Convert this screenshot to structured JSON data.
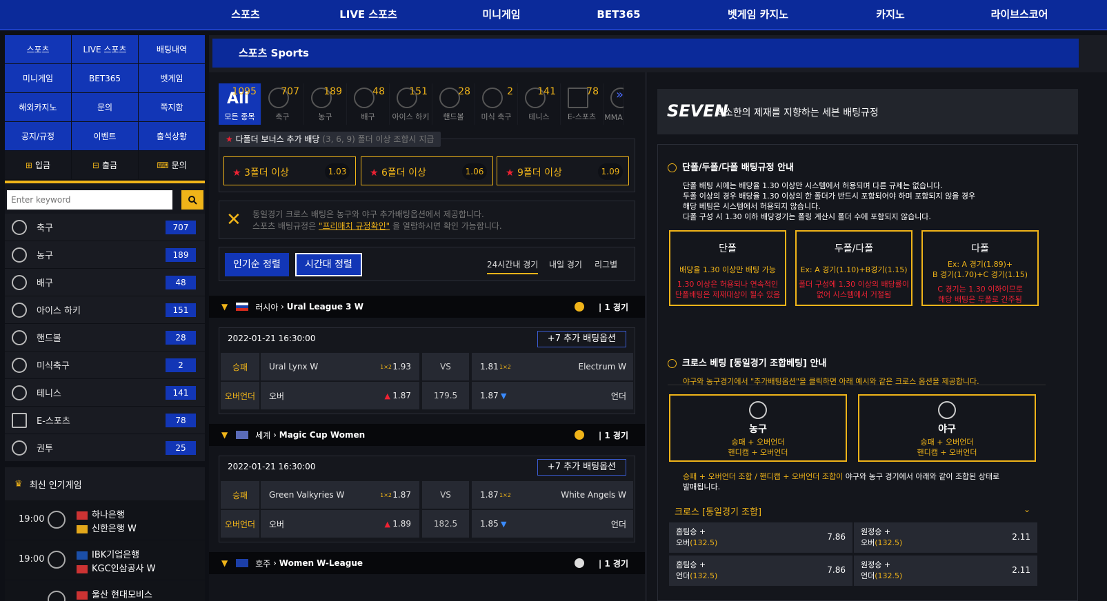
{
  "topnav": [
    "스포츠",
    "LIVE 스포츠",
    "미니게임",
    "BET365",
    "벳게임 카지노",
    "카지노",
    "라이브스코어"
  ],
  "sidenav": [
    "스포츠",
    "LIVE 스포츠",
    "배팅내역",
    "미니게임",
    "BET365",
    "벳게임",
    "해외카지노",
    "문의",
    "쪽지함",
    "공지/규정",
    "이벤트",
    "출석상황"
  ],
  "actions": [
    "입금",
    "출금",
    "문의"
  ],
  "search": {
    "placeholder": "Enter keyword"
  },
  "sports": [
    {
      "name": "축구",
      "count": "707"
    },
    {
      "name": "농구",
      "count": "189"
    },
    {
      "name": "배구",
      "count": "48"
    },
    {
      "name": "아이스 하키",
      "count": "151"
    },
    {
      "name": "핸드볼",
      "count": "28"
    },
    {
      "name": "미식축구",
      "count": "2"
    },
    {
      "name": "테니스",
      "count": "141"
    },
    {
      "name": "E-스포츠",
      "count": "78"
    },
    {
      "name": "권투",
      "count": "25"
    }
  ],
  "popular": {
    "title": "최신 인기게임",
    "games": [
      {
        "time": "19:00",
        "home": "하나은행",
        "away": "신한은행 W"
      },
      {
        "time": "19:00",
        "home": "IBK기업은행",
        "away": "KGC인삼공사 W"
      },
      {
        "time": "",
        "home": "울산 현대모비스",
        "away": ""
      }
    ]
  },
  "main_title": "스포츠 Sports",
  "sport_tabs": [
    {
      "label": "모든 종목",
      "count": "1095",
      "all": "All"
    },
    {
      "label": "축구",
      "count": "707"
    },
    {
      "label": "농구",
      "count": "189"
    },
    {
      "label": "배구",
      "count": "48"
    },
    {
      "label": "아이스 하키",
      "count": "151"
    },
    {
      "label": "핸드볼",
      "count": "28"
    },
    {
      "label": "미식 축구",
      "count": "2"
    },
    {
      "label": "테니스",
      "count": "141"
    },
    {
      "label": "E-스포츠",
      "count": "78"
    },
    {
      "label": "MMA",
      "count": ""
    }
  ],
  "bonus": {
    "tag": "다폴더 보너스 추가 배당",
    "tag_note": "(3, 6, 9) 폴더 이상 조합시 지급",
    "items": [
      {
        "label": "3폴더 이상",
        "odds": "1.03"
      },
      {
        "label": "6폴더 이상",
        "odds": "1.06"
      },
      {
        "label": "9폴더 이상",
        "odds": "1.09"
      }
    ]
  },
  "info": {
    "line1": "동일경기 크로스 배팅은 농구와 야구 추가배팅옵션에서 제공합니다.",
    "line2_pre": "스포츠 배팅규정은 ",
    "line2_link": "\"프리매치 규정확인\"",
    "line2_post": " 을 열람하시면 확인 가능합니다."
  },
  "sort": {
    "popular": "인기순 정렬",
    "time": "시간대 정렬",
    "tabs": [
      "24시간내 경기",
      "내일 경기",
      "리그별"
    ]
  },
  "leagues": [
    {
      "country": "러시아",
      "name": "Ural League 3 W",
      "count": "| 1 경기",
      "date": "2022-01-21 16:30:00",
      "more": "+7 추가 배팅옵션",
      "row1": {
        "type": "승패",
        "home": "Ural Lynx W",
        "home_odds": "1.93",
        "mid": "VS",
        "away_odds": "1.81",
        "away": "Electrum W"
      },
      "row2": {
        "type": "오버언더",
        "home": "오버",
        "home_odds": "1.87",
        "mid": "179.5",
        "away_odds": "1.87",
        "away": "언더"
      }
    },
    {
      "country": "세계",
      "name": "Magic Cup Women",
      "count": "| 1 경기",
      "date": "2022-01-21 16:30:00",
      "more": "+7 추가 배팅옵션",
      "row1": {
        "type": "승패",
        "home": "Green Valkyries W",
        "home_odds": "1.87",
        "mid": "VS",
        "away_odds": "1.87",
        "away": "White Angels W"
      },
      "row2": {
        "type": "오버언더",
        "home": "오버",
        "home_odds": "1.89",
        "mid": "182.5",
        "away_odds": "1.85",
        "away": "언더"
      }
    },
    {
      "country": "호주",
      "name": "Women W-League",
      "count": "| 1 경기"
    }
  ],
  "rules": {
    "brand": "SEVEN",
    "title": "최소한의 제재를 지향하는 세븐 배팅규정",
    "sec1": "단폴/두폴/다폴 배팅규정 안내",
    "p1": [
      "단폴 배팅 시에는 배당율 1.30 이상만 시스템에서 허용되며 다른 규제는 없습니다.",
      "두폴 이상의 경우 배당율 1.30 이상의 한 폴더가 반드시 포함되어야 하며 포함되지 않을 경우",
      "해당 베팅은 시스템에서 허용되지 않습니다.",
      "다폴 구성 시 1.30 이하 배당경기는 폴링 계산시 폴더 수에 포함되지 않습니다."
    ],
    "boxes": [
      {
        "title": "단폴",
        "yellow": [
          "배당율 1.30 이상만 배팅 가능"
        ],
        "red": [
          "1.30 이상은 허용되나 연속적인",
          "단폴배팅은 제재대상이 될수 있음"
        ]
      },
      {
        "title": "두폴/다폴",
        "yellow": [
          "Ex: A 경기(1.10)+B경기(1.15)"
        ],
        "red": [
          "폴더 구성에 1.30 이상의 배당률이",
          "없어 시스템에서 거절됨"
        ]
      },
      {
        "title": "다폴",
        "yellow": [
          "Ex: A 경기(1.89)+",
          "B 경기(1.70)+C 경기(1.15)"
        ],
        "red": [
          "C 경기는 1.30 이하이므로",
          "해당 배팅은 두폴로 간주됨"
        ]
      }
    ],
    "sec2": "크로스 베팅 [동일경기 조합베팅] 안내",
    "p2": "야구와 농구경기에서 \"추가배팅옵션\"을 클릭하면 아래 예시와 같은 크로스 옵션을 제공합니다.",
    "cross": [
      {
        "title": "농구",
        "l1": "승패 + 오버언더",
        "l2": "핸디캡 + 오버언더"
      },
      {
        "title": "야구",
        "l1": "승패 + 오버언더",
        "l2": "핸디캡 + 오버언더"
      }
    ],
    "p3_y": "승패 + 오버언더 조합 / 핸디캡 + 오버언더 조합이",
    "p3_w": " 야구와 농구 경기에서 아래와 같이 조합된 상태로",
    "p3_w2": "발매됩니다.",
    "cross_hdr": "크로스 [동일경기 조합]",
    "odds": [
      {
        "l1": "홈팀승 +",
        "l2": "오버",
        "line": "(132.5)",
        "v": "7.86"
      },
      {
        "l1": "원정승 +",
        "l2": "오버",
        "line": "(132.5)",
        "v": "2.11"
      },
      {
        "l1": "홈팀승 +",
        "l2": "언더",
        "line": "(132.5)",
        "v": "7.86"
      },
      {
        "l1": "원정승 +",
        "l2": "언더",
        "line": "(132.5)",
        "v": "2.11"
      }
    ]
  },
  "colors": {
    "primary": "#1236b6",
    "gold": "#f0b419",
    "bg": "#0e1016"
  }
}
